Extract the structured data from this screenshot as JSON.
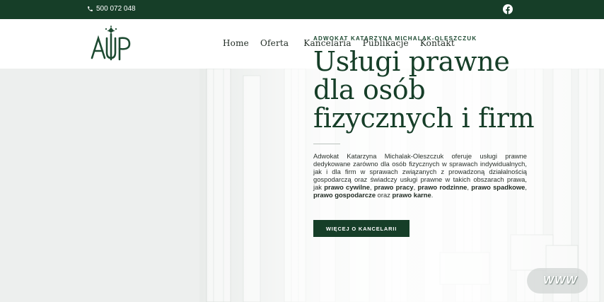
{
  "topbar": {
    "phone": "500 072 048",
    "phone_icon": "phone-icon",
    "social_icon": "facebook-icon"
  },
  "header": {
    "logo_icon": "law-office-logo",
    "nav": [
      "Home",
      "Oferta",
      "Kancelaria",
      "Publikacje",
      "Kontakt"
    ]
  },
  "hero": {
    "eyebrow": "ADWOKAT KATARZYNA MICHALAK-OLESZCZUK",
    "title_lines": [
      "Usługi prawne",
      "dla osób",
      "fizycznych i firm"
    ],
    "description_intro": "Adwokat Katarzyna Michalak-Oleszczuk oferuje usługi prawne dedykowane zarówno dla osób fizycznych w sprawach indywidualnych, jak i dla firm w sprawach związanych z prowadzoną działalnością gospodarczą oraz świadczy usługi prawne w takich obszarach prawa, jak",
    "areas": [
      "prawo cywilne",
      "prawo pracy",
      "prawo rodzinne",
      "prawo spadkowe",
      "prawo gospodarcze"
    ],
    "connector_oraz": "oraz",
    "last_area": "prawo karne",
    "cta": "WIĘCEJ O KANCELARII",
    "watermark": "WWW"
  },
  "colors": {
    "brand_green": "#163e28",
    "background": "#ffffff",
    "hero_left": "#edefee"
  }
}
